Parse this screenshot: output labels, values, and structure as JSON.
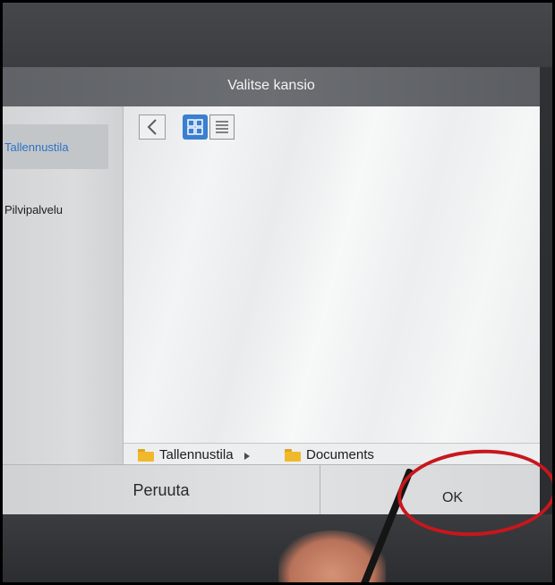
{
  "dialog": {
    "title": "Valitse kansio"
  },
  "sidebar": {
    "items": [
      {
        "label": "Tallennustila",
        "selected": true
      },
      {
        "label": "Pilvipalvelu",
        "selected": false
      }
    ]
  },
  "toolbar": {
    "back_icon": "chevron-left-icon",
    "grid_view_icon": "grid-view-icon",
    "list_view_icon": "list-view-icon",
    "active_view": "grid"
  },
  "breadcrumb": {
    "items": [
      {
        "label": "Tallennustila",
        "icon": "folder-icon"
      },
      {
        "label": "Documents",
        "icon": "folder-icon"
      }
    ],
    "separator_icon": "caret-right-icon"
  },
  "buttons": {
    "cancel_label": "Peruuta",
    "ok_label": "OK"
  },
  "colors": {
    "accent": "#3a7fd0",
    "selected_text": "#2b73c4",
    "folder": "#f0b92b",
    "annotation": "#c8161d",
    "header": "#66696d"
  }
}
